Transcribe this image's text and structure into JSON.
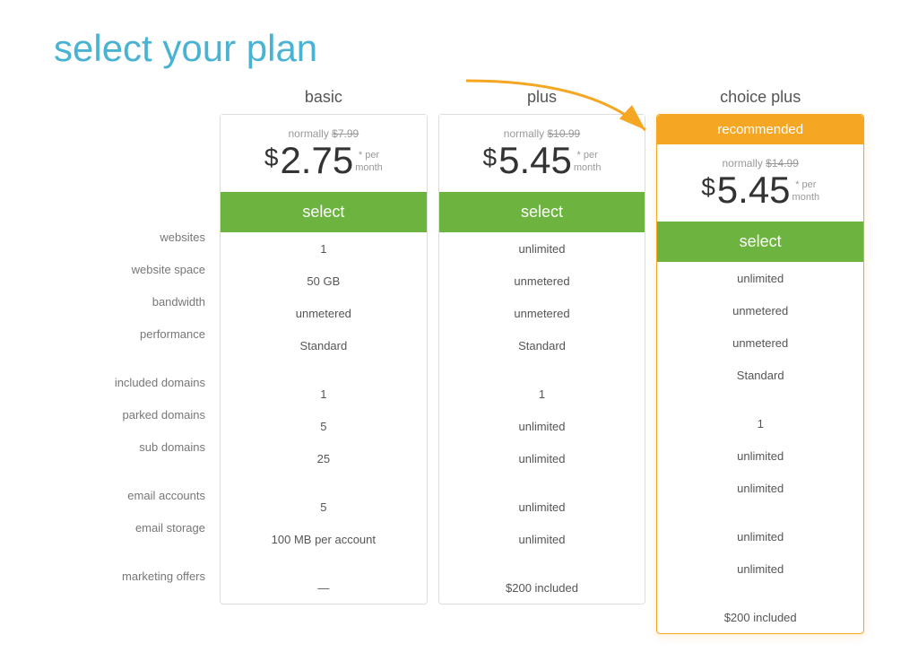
{
  "page": {
    "title": "select your plan"
  },
  "plans": [
    {
      "id": "basic",
      "name": "basic",
      "recommended": false,
      "normally_label": "normally",
      "original_price": "$7.99",
      "price_dollar": "$",
      "price_amount": "2.75",
      "price_asterisk": "*",
      "price_per": "per\nmonth",
      "select_label": "select",
      "features": {
        "websites": "1",
        "website_space": "50 GB",
        "bandwidth": "unmetered",
        "performance": "Standard",
        "included_domains": "1",
        "parked_domains": "5",
        "sub_domains": "25",
        "email_accounts": "5",
        "email_storage": "100 MB per account",
        "marketing_offers": "—"
      }
    },
    {
      "id": "plus",
      "name": "plus",
      "recommended": false,
      "normally_label": "normally",
      "original_price": "$10.99",
      "price_dollar": "$",
      "price_amount": "5.45",
      "price_asterisk": "*",
      "price_per": "per\nmonth",
      "select_label": "select",
      "features": {
        "websites": "unlimited",
        "website_space": "unmetered",
        "bandwidth": "unmetered",
        "performance": "Standard",
        "included_domains": "1",
        "parked_domains": "unlimited",
        "sub_domains": "unlimited",
        "email_accounts": "unlimited",
        "email_storage": "unlimited",
        "marketing_offers": "$200 included"
      }
    },
    {
      "id": "choice_plus",
      "name": "choice plus",
      "recommended": true,
      "recommended_label": "recommended",
      "normally_label": "normally",
      "original_price": "$14.99",
      "price_dollar": "$",
      "price_amount": "5.45",
      "price_asterisk": "*",
      "price_per": "per\nmonth",
      "select_label": "select",
      "features": {
        "websites": "unlimited",
        "website_space": "unmetered",
        "bandwidth": "unmetered",
        "performance": "Standard",
        "included_domains": "1",
        "parked_domains": "unlimited",
        "sub_domains": "unlimited",
        "email_accounts": "unlimited",
        "email_storage": "unlimited",
        "marketing_offers": "$200 included"
      }
    }
  ],
  "feature_labels": [
    {
      "key": "websites",
      "label": "websites"
    },
    {
      "key": "website_space",
      "label": "website space"
    },
    {
      "key": "bandwidth",
      "label": "bandwidth"
    },
    {
      "key": "performance",
      "label": "performance"
    },
    {
      "key": "spacer1",
      "label": "",
      "spacer": true
    },
    {
      "key": "included_domains",
      "label": "included domains"
    },
    {
      "key": "parked_domains",
      "label": "parked domains"
    },
    {
      "key": "sub_domains",
      "label": "sub domains"
    },
    {
      "key": "spacer2",
      "label": "",
      "spacer": true
    },
    {
      "key": "email_accounts",
      "label": "email accounts"
    },
    {
      "key": "email_storage",
      "label": "email storage"
    },
    {
      "key": "spacer3",
      "label": "",
      "spacer": true
    },
    {
      "key": "marketing_offers",
      "label": "marketing offers"
    }
  ]
}
